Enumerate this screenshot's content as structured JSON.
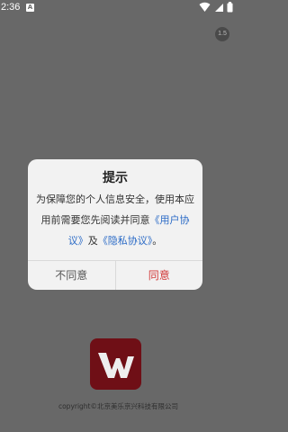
{
  "status_bar": {
    "time": "2:36",
    "notification_letter": "A",
    "icons": [
      "wifi-icon",
      "signal-icon",
      "battery-icon"
    ]
  },
  "skip_badge": {
    "text": "1.5"
  },
  "dialog": {
    "title": "提示",
    "body_prefix": "为保障您的个人信息安全，使用本应用前需要您先阅读并同意",
    "user_agreement_link": "《用户协议》",
    "conjunction": "及",
    "privacy_policy_link": "《隐私协议》",
    "body_suffix": "。",
    "disagree_label": "不同意",
    "agree_label": "同意"
  },
  "footer": {
    "logo_icon": "w-logo-icon",
    "copyright": "copyright©北京美乐京兴科技有限公司"
  },
  "colors": {
    "overlay": "#686868",
    "dialog_bg": "#f2f2f2",
    "link": "#2a6ac6",
    "agree": "#d23a3a",
    "logo_bg": "#6f0f16"
  }
}
